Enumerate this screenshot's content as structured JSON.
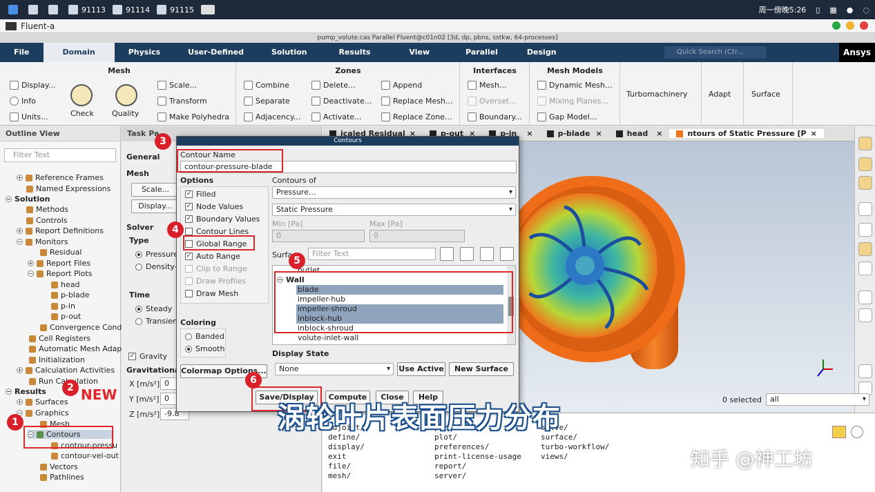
{
  "taskbar": {
    "items": [
      "91113",
      "91114",
      "91115"
    ],
    "clock": "周一傍晚5:26"
  },
  "window": {
    "title": "Fluent-a",
    "app_title": "pump_volute.cas Parallel Fluent@c01n02  [3d, dp, pbns, sstkw, 64-processes]"
  },
  "ribbon_tabs": [
    "File",
    "Domain",
    "Physics",
    "User-Defined",
    "Solution",
    "Results",
    "View",
    "Parallel",
    "Design"
  ],
  "quick_search": "Quick Search (Ctr...",
  "brand": "Ansys",
  "ribbon": {
    "mesh": {
      "title": "Mesh",
      "display": "Display...",
      "info": "Info",
      "units": "Units...",
      "check": "Check",
      "quality": "Quality",
      "scale": "Scale...",
      "transform": "Transform",
      "make_polyhedra": "Make Polyhedra"
    },
    "zones": {
      "title": "Zones",
      "combine": "Combine",
      "separate": "Separate",
      "adjacency": "Adjacency...",
      "delete": "Delete...",
      "deactivate": "Deactivate...",
      "activate": "Activate...",
      "append": "Append",
      "replace_mesh": "Replace Mesh...",
      "replace_zone": "Replace Zone..."
    },
    "interfaces": {
      "title": "Interfaces",
      "mesh": "Mesh...",
      "overset": "Overset...",
      "boundary": "Boundary..."
    },
    "mesh_models": {
      "title": "Mesh Models",
      "dynamic_mesh": "Dynamic Mesh...",
      "mixing_planes": "Mixing Planes...",
      "gap_model": "Gap Model..."
    },
    "turbomachinery": "Turbomachinery",
    "adapt": "Adapt",
    "surface": "Surface"
  },
  "outline": {
    "title": "Outline View",
    "filter_placeholder": "Filter Text",
    "items": {
      "reference_frames": "Reference Frames",
      "named_expressions": "Named Expressions",
      "solution": "Solution",
      "methods": "Methods",
      "controls": "Controls",
      "report_definitions": "Report Definitions",
      "monitors": "Monitors",
      "residual": "Residual",
      "report_files": "Report Files",
      "report_plots": "Report Plots",
      "head": "head",
      "p_blade": "p-blade",
      "p_in": "p-in",
      "p_out": "p-out",
      "convergence": "Convergence Cond",
      "cell_registers": "Cell Registers",
      "automatic_mesh": "Automatic Mesh Adap",
      "initialization": "Initialization",
      "calc_activities": "Calculation Activities",
      "run_calc": "Run Calculation",
      "results": "Results",
      "surfaces": "Surfaces",
      "graphics": "Graphics",
      "mesh": "Mesh",
      "contours": "Contours",
      "contour_pressure": "contour-pressu",
      "contour_vel": "contour-vel-out",
      "vectors": "Vectors",
      "pathlines": "Pathlines"
    }
  },
  "task_page": {
    "title": "Task Pa",
    "general": "General",
    "mesh": "Mesh",
    "scale_btn": "Scale...",
    "display_btn": "Display...",
    "solver": "Solver",
    "type": "Type",
    "pressure": "Pressure",
    "density": "Density-",
    "time": "Time",
    "steady": "Steady",
    "transient": "Transien",
    "gravity": "Gravity",
    "gravitational": "Gravitationa",
    "x_label": "X [m/s²]",
    "x_val": "0",
    "y_label": "Y [m/s²]",
    "y_val": "0",
    "z_label": "Z [m/s²]",
    "z_val": "-9.8"
  },
  "graphics_tabs": [
    "icaled Residual",
    "p-out",
    "p-in",
    "p-blade",
    "head",
    "ntours of Static Pressure [P"
  ],
  "selection": {
    "count": "0 selected",
    "filter": "all"
  },
  "console": {
    "col1": [
      "adjoint/",
      "define/",
      "display/",
      "exit",
      "file/",
      "mesh/"
    ],
    "col2": [
      "parallel/",
      "plot/",
      "preferences/",
      "print-license-usage",
      "report/",
      "server/"
    ],
    "col3": [
      "solve/",
      "surface/",
      "turbo-workflow/",
      "views/"
    ]
  },
  "dialog": {
    "title": "Contours",
    "contour_name_label": "Contour Name",
    "contour_name": "contour-pressure-blade",
    "options_label": "Options",
    "options": [
      {
        "label": "Filled",
        "checked": true,
        "enabled": true
      },
      {
        "label": "Node Values",
        "checked": true,
        "enabled": true
      },
      {
        "label": "Boundary Values",
        "checked": true,
        "enabled": true
      },
      {
        "label": "Contour Lines",
        "checked": false,
        "enabled": true
      },
      {
        "label": "Global Range",
        "checked": false,
        "enabled": true
      },
      {
        "label": "Auto Range",
        "checked": true,
        "enabled": true
      },
      {
        "label": "Clip to Range",
        "checked": false,
        "enabled": false
      },
      {
        "label": "Draw Profiles",
        "checked": false,
        "enabled": false
      },
      {
        "label": "Draw Mesh",
        "checked": false,
        "enabled": true
      }
    ],
    "contours_of_label": "Contours of",
    "contours_of": "Pressure...",
    "sub_quantity": "Static Pressure",
    "min_label": "Min [Pa]",
    "min_val": "0",
    "max_label": "Max [Pa]",
    "max_val": "0",
    "surfaces_label": "Surfa",
    "surfaces_filter": "Filter Text",
    "surface_list": {
      "outlet": "outlet",
      "group": "Wall",
      "items": [
        {
          "label": "blade",
          "selected": true
        },
        {
          "label": "impeller-hub",
          "selected": false
        },
        {
          "label": "impeller-shroud",
          "selected": true
        },
        {
          "label": "inblock-hub",
          "selected": true
        },
        {
          "label": "inblock-shroud",
          "selected": false
        },
        {
          "label": "volute-inlet-wall",
          "selected": false
        }
      ]
    },
    "coloring_label": "Coloring",
    "banded": "Banded",
    "smooth": "Smooth",
    "colormap_btn": "Colormap Options...",
    "display_state_label": "Display State",
    "display_state": "None",
    "use_active_btn": "Use Active",
    "new_surface_btn": "New Surface",
    "save_btn": "Save/Display",
    "compute_btn": "Compute",
    "close_btn": "Close",
    "help_btn": "Help"
  },
  "annotations": {
    "steps": [
      "1",
      "2",
      "3",
      "4",
      "5",
      "6"
    ],
    "new_label": "NEW",
    "caption": "涡轮叶片表面压力分布",
    "watermark": "知乎 @神工坊"
  },
  "colors": {
    "ribbon_bar": "#1d3d5f",
    "annotation_red": "#e0262a",
    "volute_orange": "#f0741e",
    "selection": "#8fa5bd"
  }
}
